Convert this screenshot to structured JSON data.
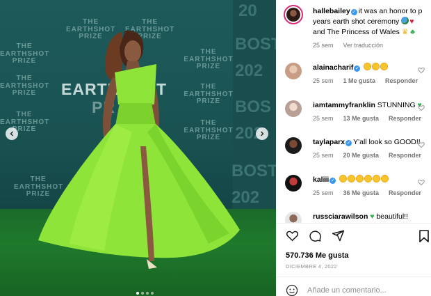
{
  "media": {
    "brand_texts": [
      "THE EARTHSHOT PRIZE",
      "THE EARTHSHOT PRIZE",
      "THE EARTHSHOT PRIZE",
      "THE EARTHSHOT PRIZE",
      "THE EARTHSHOT PRIZE",
      "THE EARTHSHOT PRIZE",
      "THE EARTHSHOT PRIZE",
      "THE EARTHSHOT PRIZE",
      "THE EARTHSHOT PRIZE"
    ],
    "big_text": "EARTHSHOT",
    "big_text_2": "PR",
    "bos_1": "20",
    "bos_2": "BOST",
    "bos_3": "202",
    "bos_4": "BOS",
    "bos_5": "202",
    "bos_6": "BOSTO",
    "bos_7": "202",
    "gown_color": "#8fe43a",
    "backdrop_color": "#1e5a5a",
    "carpet_color": "#1f7a2c"
  },
  "caption": {
    "username": "hallebailey",
    "text": "it was an honor to p",
    "line2": "years earth shot ceremony",
    "line3": "and The Princess of Wales",
    "time": "25 sem",
    "translate": "Ver traducción"
  },
  "comments": [
    {
      "username": "alainacharif",
      "verified": true,
      "text": "",
      "emoji_count": 3,
      "time": "25 sem",
      "likes": "1 Me gusta",
      "reply": "Responder"
    },
    {
      "username": "iamtammyfranklin",
      "verified": false,
      "text": "STUNNING",
      "time": "25 sem",
      "likes": "13 Me gusta",
      "reply": "Responder"
    },
    {
      "username": "taylaparx",
      "verified": true,
      "text": "Y'all look so GOOD!!",
      "time": "25 sem",
      "likes": "20 Me gusta",
      "reply": "Responder"
    },
    {
      "username": "kaliii",
      "verified": true,
      "text": "",
      "emoji_count": 6,
      "time": "25 sem",
      "likes": "36 Me gusta",
      "reply": "Responder"
    },
    {
      "username": "russciarawilson",
      "verified": false,
      "text": "beautiful!!",
      "time": "",
      "likes": "",
      "reply": ""
    }
  ],
  "likes_count": "570.736 Me gusta",
  "date": "DICIEMBRE 4, 2022",
  "add_comment_placeholder": "Añade un comentario..."
}
